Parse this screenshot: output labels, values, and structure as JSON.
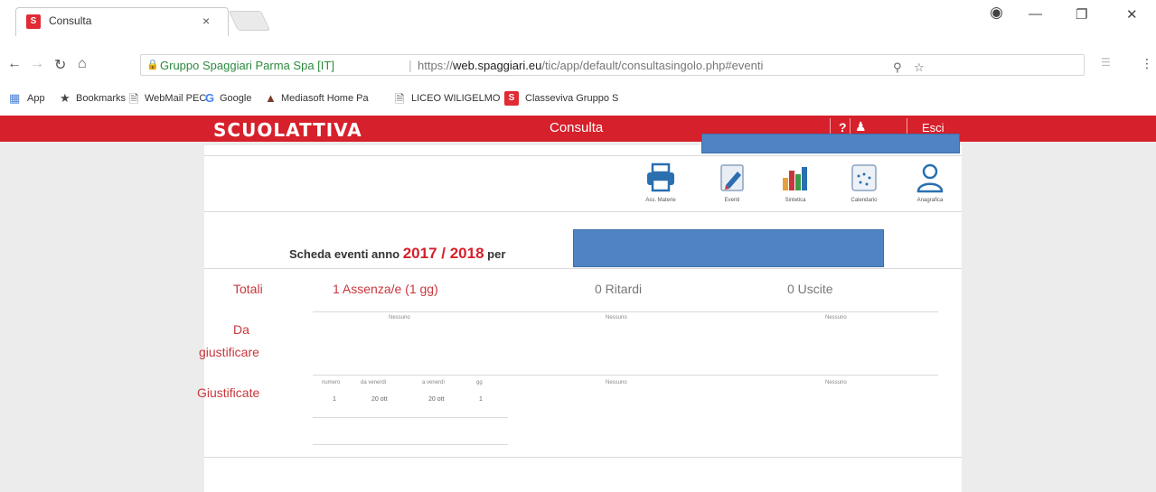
{
  "browser": {
    "tab_title": "Consulta",
    "tab_close": "×",
    "site_name": "Gruppo Spaggiari Parma Spa [IT]",
    "url_scheme": "https://",
    "url_host": "web.spaggiari.eu",
    "url_path": "/tic/app/default/consultasingolo.php#eventi",
    "bookmarks": [
      "App",
      "Bookmarks",
      "WebMail PEC",
      "Google",
      "Mediasoft Home Pa",
      "LICEO WILIGELMO",
      "Classeviva Gruppo S"
    ]
  },
  "header": {
    "logo": "SCUOLATTIVA",
    "title": "Consulta",
    "help": "?",
    "logout": "Esci"
  },
  "toolbar": {
    "items": [
      "Ass. Materie",
      "Eventi",
      "Sintetica",
      "Calendario",
      "Anagrafica"
    ]
  },
  "scheda": {
    "prefix": "Scheda eventi anno",
    "year": "2017 / 2018",
    "suffix": "per"
  },
  "totali": {
    "label": "Totali",
    "assenze": "1 Assenza/e (1 gg)",
    "ritardi": "0  Ritardi",
    "uscite": "0  Uscite"
  },
  "da_giustificare": {
    "label_line1": "Da",
    "label_line2": "giustificare",
    "assenze": "Nessuno",
    "ritardi": "Nessuno",
    "uscite": "Nessuno"
  },
  "giustificate": {
    "label": "Giustificate",
    "columns": [
      "numero",
      "da venerdì",
      "a venerdì",
      "gg"
    ],
    "row": [
      "1",
      "20 ott",
      "20 ott",
      "1"
    ],
    "ritardi": "Nessuno",
    "uscite": "Nessuno"
  },
  "colors": {
    "brand_red": "#d6202b",
    "label_red": "#c9363d",
    "redaction_blue": "#4f84c4"
  }
}
